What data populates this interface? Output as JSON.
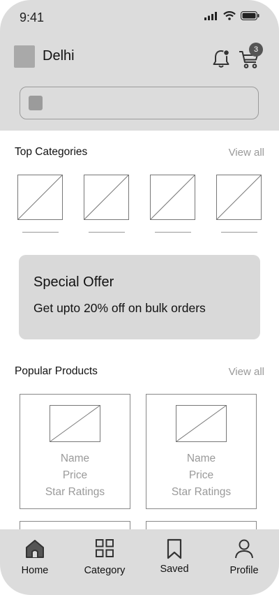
{
  "status_bar": {
    "time": "9:41"
  },
  "header": {
    "location": "Delhi",
    "cart_count": "3",
    "search": {
      "placeholder": "",
      "value": ""
    }
  },
  "top_categories": {
    "title": "Top Categories",
    "view_all": "View all",
    "items": [
      {},
      {},
      {},
      {}
    ]
  },
  "offer": {
    "title": "Special Offer",
    "subtitle": "Get upto 20% off on bulk orders"
  },
  "popular_products": {
    "title": "Popular Products",
    "view_all": "View all",
    "items": [
      {
        "name": "Name",
        "price": "Price",
        "rating": "Star Ratings"
      },
      {
        "name": "Name",
        "price": "Price",
        "rating": "Star Ratings"
      }
    ]
  },
  "bottom_nav": {
    "items": [
      {
        "label": "Home",
        "icon": "home-icon"
      },
      {
        "label": "Category",
        "icon": "grid-icon"
      },
      {
        "label": "Saved",
        "icon": "bookmark-icon"
      },
      {
        "label": "Profile",
        "icon": "user-icon"
      }
    ]
  }
}
